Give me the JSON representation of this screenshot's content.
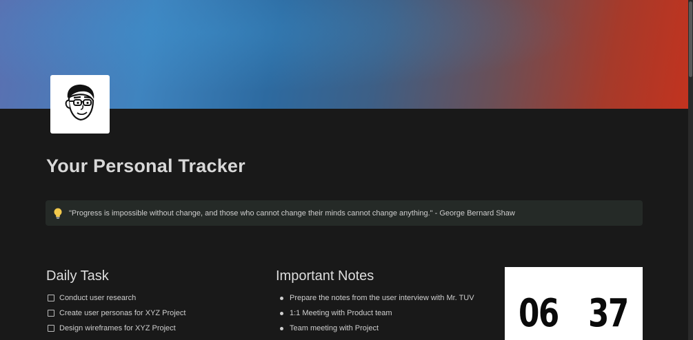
{
  "page": {
    "title": "Your Personal Tracker",
    "cover_colors": [
      "#5b6fb0",
      "#3f84bf",
      "#2d6aa0",
      "#6a4f57",
      "#c2331f"
    ],
    "avatar_icon": "cartoon-face-with-glasses-icon"
  },
  "callout": {
    "icon": "lightbulb-icon",
    "text": "\"Progress is impossible without change, and those who cannot change their minds cannot change anything.\" - George Bernard Shaw"
  },
  "daily_task": {
    "heading": "Daily Task",
    "items": [
      {
        "label": "Conduct user research",
        "checked": false
      },
      {
        "label": "Create user personas for XYZ Project",
        "checked": false
      },
      {
        "label": "Design wireframes for XYZ Project",
        "checked": false
      }
    ]
  },
  "important_notes": {
    "heading": "Important Notes",
    "items": [
      "Prepare the notes from the user interview with Mr. TUV",
      "1:1 Meeting with Product team",
      "Team meeting with Project"
    ]
  },
  "clock": {
    "hours": "06",
    "minutes": "37"
  }
}
